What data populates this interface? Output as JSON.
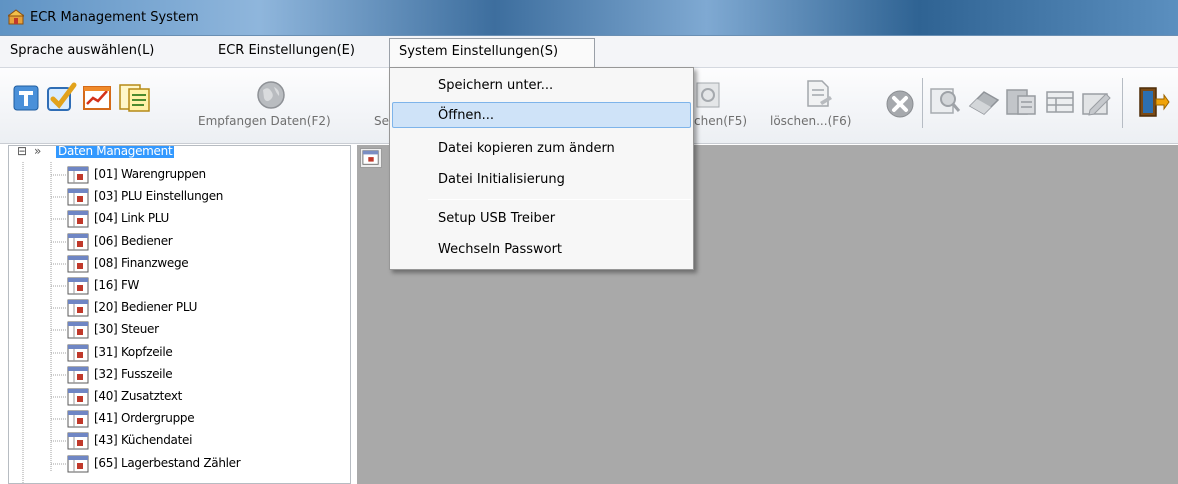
{
  "window": {
    "title": "ECR Management System",
    "icon": "app-icon"
  },
  "menubar": {
    "items": [
      {
        "label": "Sprache auswählen(L)"
      },
      {
        "label": "ECR Einstellungen(E)"
      },
      {
        "label": "System Einstellungen(S)"
      }
    ]
  },
  "toolbar": {
    "labels": {
      "empfangen": "Empfangen Daten(F2)",
      "senden_partial": "Se",
      "loeschen_f5": "chen(F5)",
      "loeschen_f6": "löschen...(F6)"
    },
    "icons": [
      "help-icon",
      "check-icon",
      "chart-icon",
      "document-icon",
      "globe-icon",
      "document-edit-icon",
      "cancel-icon",
      "search-tool-icon",
      "eraser-icon",
      "report-icon",
      "table-icon",
      "edit-icon",
      "exit-icon"
    ]
  },
  "system_menu": {
    "items": [
      {
        "label": "Speichern unter..."
      },
      {
        "label": "Öffnen..."
      },
      {
        "label": "Datei kopieren zum ändern"
      },
      {
        "label": "Datei Initialisierung"
      },
      {
        "label": "Setup USB Treiber"
      },
      {
        "label": "Wechseln Passwort"
      }
    ],
    "highlighted_index": 1
  },
  "tree": {
    "root": {
      "label": "Daten Management",
      "expander": "⊟",
      "arrow": "»"
    },
    "items": [
      {
        "label": "[01] Warengruppen"
      },
      {
        "label": "[03] PLU Einstellungen"
      },
      {
        "label": "[04] Link PLU"
      },
      {
        "label": "[06] Bediener"
      },
      {
        "label": "[08] Finanzwege"
      },
      {
        "label": "[16] FW"
      },
      {
        "label": "[20] Bediener PLU"
      },
      {
        "label": "[30] Steuer"
      },
      {
        "label": "[31] Kopfzeile"
      },
      {
        "label": "[32] Fusszeile"
      },
      {
        "label": "[40] Zusatztext"
      },
      {
        "label": "[41] Ordergruppe"
      },
      {
        "label": "[43] Küchendatei"
      },
      {
        "label": "[65] Lagerbestand Zähler"
      }
    ]
  },
  "colors": {
    "selection": "#3399ff",
    "menu_hover": "#cfe3f8",
    "workspace": "#a9a9a9"
  }
}
